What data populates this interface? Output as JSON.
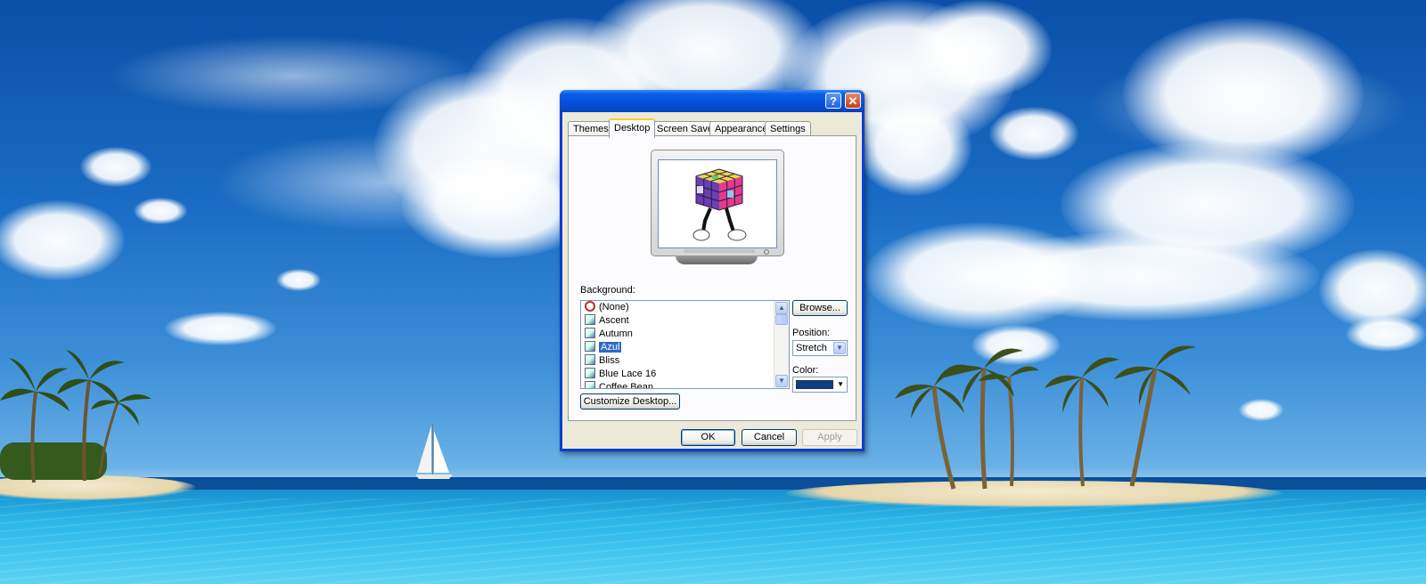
{
  "dialog": {
    "title_buttons": {
      "help": "?",
      "close": "✕"
    },
    "tabs": [
      {
        "label": "Themes",
        "active": false
      },
      {
        "label": "Desktop",
        "active": true
      },
      {
        "label": "Screen Saver",
        "active": false
      },
      {
        "label": "Appearance",
        "active": false
      },
      {
        "label": "Settings",
        "active": false
      }
    ],
    "background_label": "Background:",
    "background_items": [
      {
        "label": "(None)",
        "icon": "no-background-icon",
        "selected": false
      },
      {
        "label": "Ascent",
        "icon": "image-file-icon",
        "selected": false
      },
      {
        "label": "Autumn",
        "icon": "image-file-icon",
        "selected": false
      },
      {
        "label": "Azul",
        "icon": "image-file-icon",
        "selected": true
      },
      {
        "label": "Bliss",
        "icon": "image-file-icon",
        "selected": false
      },
      {
        "label": "Blue Lace 16",
        "icon": "image-file-icon",
        "selected": false
      },
      {
        "label": "Coffee Bean",
        "icon": "image-file-icon",
        "selected": false
      }
    ],
    "browse_label": "Browse...",
    "position_label": "Position:",
    "position_value": "Stretch",
    "color_label": "Color:",
    "color_value": "#0a3f8c",
    "customize_label": "Customize Desktop...",
    "ok_label": "OK",
    "cancel_label": "Cancel",
    "apply_label": "Apply"
  },
  "colors": {
    "titlebar": "#0550d8",
    "selection": "#316ac5",
    "active_tab_accent": "#ffc83c"
  }
}
